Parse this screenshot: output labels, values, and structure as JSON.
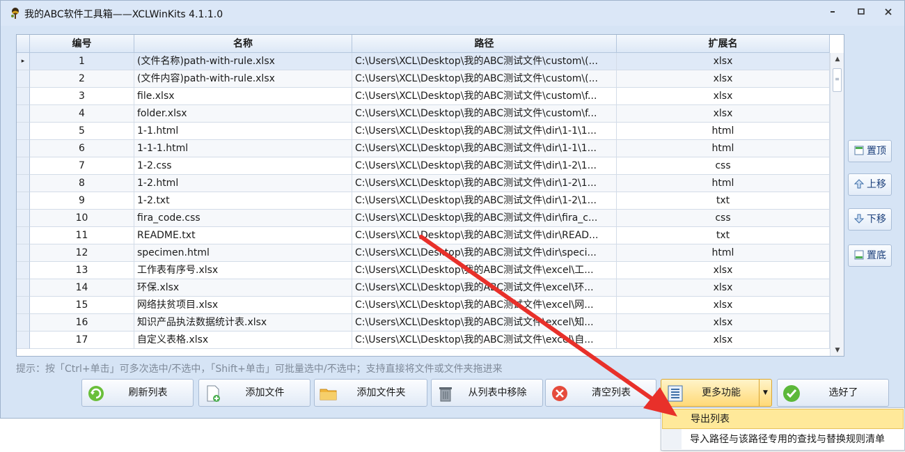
{
  "window": {
    "title": "我的ABC软件工具箱——XCLWinKits  4.1.1.0",
    "controls": {
      "minimize": "▫",
      "maximize": "▣",
      "close": "✕"
    }
  },
  "table": {
    "columns": [
      "编号",
      "名称",
      "路径",
      "扩展名"
    ],
    "rows": [
      {
        "idx": "1",
        "name": "(文件名称)path-with-rule.xlsx",
        "path": "C:\\Users\\XCL\\Desktop\\我的ABC测试文件\\custom\\(...",
        "ext": "xlsx"
      },
      {
        "idx": "2",
        "name": "(文件内容)path-with-rule.xlsx",
        "path": "C:\\Users\\XCL\\Desktop\\我的ABC测试文件\\custom\\(...",
        "ext": "xlsx"
      },
      {
        "idx": "3",
        "name": "file.xlsx",
        "path": "C:\\Users\\XCL\\Desktop\\我的ABC测试文件\\custom\\f...",
        "ext": "xlsx"
      },
      {
        "idx": "4",
        "name": "folder.xlsx",
        "path": "C:\\Users\\XCL\\Desktop\\我的ABC测试文件\\custom\\f...",
        "ext": "xlsx"
      },
      {
        "idx": "5",
        "name": "1-1.html",
        "path": "C:\\Users\\XCL\\Desktop\\我的ABC测试文件\\dir\\1-1\\1...",
        "ext": "html"
      },
      {
        "idx": "6",
        "name": "1-1-1.html",
        "path": "C:\\Users\\XCL\\Desktop\\我的ABC测试文件\\dir\\1-1\\1...",
        "ext": "html"
      },
      {
        "idx": "7",
        "name": "1-2.css",
        "path": "C:\\Users\\XCL\\Desktop\\我的ABC测试文件\\dir\\1-2\\1...",
        "ext": "css"
      },
      {
        "idx": "8",
        "name": "1-2.html",
        "path": "C:\\Users\\XCL\\Desktop\\我的ABC测试文件\\dir\\1-2\\1...",
        "ext": "html"
      },
      {
        "idx": "9",
        "name": "1-2.txt",
        "path": "C:\\Users\\XCL\\Desktop\\我的ABC测试文件\\dir\\1-2\\1...",
        "ext": "txt"
      },
      {
        "idx": "10",
        "name": "fira_code.css",
        "path": "C:\\Users\\XCL\\Desktop\\我的ABC测试文件\\dir\\fira_c...",
        "ext": "css"
      },
      {
        "idx": "11",
        "name": "README.txt",
        "path": "C:\\Users\\XCL\\Desktop\\我的ABC测试文件\\dir\\READ...",
        "ext": "txt"
      },
      {
        "idx": "12",
        "name": "specimen.html",
        "path": "C:\\Users\\XCL\\Desktop\\我的ABC测试文件\\dir\\speci...",
        "ext": "html"
      },
      {
        "idx": "13",
        "name": "工作表有序号.xlsx",
        "path": "C:\\Users\\XCL\\Desktop\\我的ABC测试文件\\excel\\工...",
        "ext": "xlsx"
      },
      {
        "idx": "14",
        "name": "环保.xlsx",
        "path": "C:\\Users\\XCL\\Desktop\\我的ABC测试文件\\excel\\环...",
        "ext": "xlsx"
      },
      {
        "idx": "15",
        "name": "网络扶贫项目.xlsx",
        "path": "C:\\Users\\XCL\\Desktop\\我的ABC测试文件\\excel\\网...",
        "ext": "xlsx"
      },
      {
        "idx": "16",
        "name": "知识产品执法数据统计表.xlsx",
        "path": "C:\\Users\\XCL\\Desktop\\我的ABC测试文件\\excel\\知...",
        "ext": "xlsx"
      },
      {
        "idx": "17",
        "name": "自定义表格.xlsx",
        "path": "C:\\Users\\XCL\\Desktop\\我的ABC测试文件\\excel\\自...",
        "ext": "xlsx"
      }
    ],
    "selected_row_marker": "▸"
  },
  "side_buttons": {
    "top": "置顶",
    "up": "上移",
    "down": "下移",
    "bottom": "置底"
  },
  "hint": "提示：按「Ctrl+单击」可多次选中/不选中，「Shift+单击」可批量选中/不选中；支持直接将文件或文件夹拖进来",
  "buttons": {
    "refresh": "刷新列表",
    "add_file": "添加文件",
    "add_folder": "添加文件夹",
    "remove": "从列表中移除",
    "clear": "清空列表",
    "more": "更多功能",
    "done": "选好了"
  },
  "more_menu": {
    "items": [
      "导出列表",
      "导入路径与该路径专用的查找与替换规则清单"
    ]
  },
  "colors": {
    "window_bg": "#d6e4f5",
    "active_button": "#ffd977",
    "menu_highlight": "#ffe99a",
    "arrow": "#e8302a"
  }
}
